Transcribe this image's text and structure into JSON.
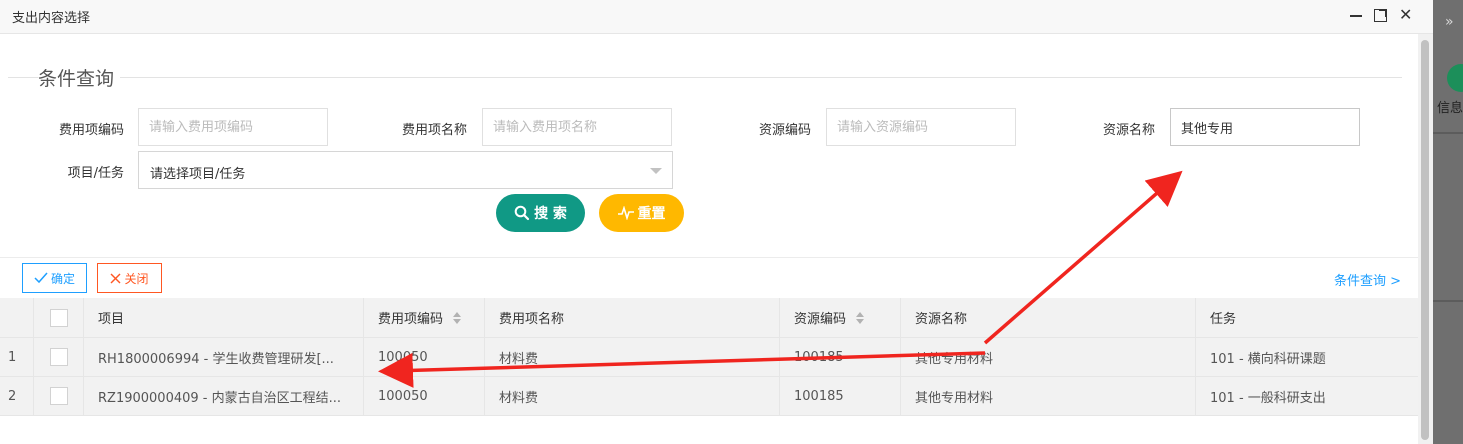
{
  "dialog": {
    "title": "支出内容选择"
  },
  "backdrop": {
    "chevron": "»",
    "side_text": "信息"
  },
  "filter": {
    "legend": "条件查询",
    "fields": {
      "fee_code": {
        "label": "费用项编码",
        "placeholder": "请输入费用项编码",
        "value": ""
      },
      "fee_name": {
        "label": "费用项名称",
        "placeholder": "请输入费用项名称",
        "value": ""
      },
      "res_code": {
        "label": "资源编码",
        "placeholder": "请输入资源编码",
        "value": ""
      },
      "res_name": {
        "label": "资源名称",
        "placeholder": "",
        "value": "其他专用"
      },
      "project": {
        "label": "项目/任务",
        "selected": "请选择项目/任务"
      }
    },
    "search_label": "搜 索",
    "reset_label": "重置"
  },
  "toolbar": {
    "confirm_label": "确定",
    "close_label": "关闭",
    "condition_link": "条件查询 >"
  },
  "table": {
    "columns": [
      "项目",
      "费用项编码",
      "费用项名称",
      "资源编码",
      "资源名称",
      "任务"
    ],
    "rows": [
      {
        "index": "1",
        "project": "RH1800006994 - 学生收费管理研发[...",
        "fee_code": "100050",
        "fee_name": "材料费",
        "res_code": "100185",
        "res_name": "其他专用材料",
        "task": "101 - 横向科研课题"
      },
      {
        "index": "2",
        "project": "RZ1900000409 - 内蒙古自治区工程结...",
        "fee_code": "100050",
        "fee_name": "材料费",
        "res_code": "100185",
        "res_name": "其他专用材料",
        "task": "101 - 一般科研支出"
      }
    ]
  },
  "colors": {
    "search_button": "#109985",
    "reset_button": "#ffb800",
    "confirm": "#1e9fff",
    "close": "#ff5722",
    "annotation_arrow": "#f0251f"
  }
}
